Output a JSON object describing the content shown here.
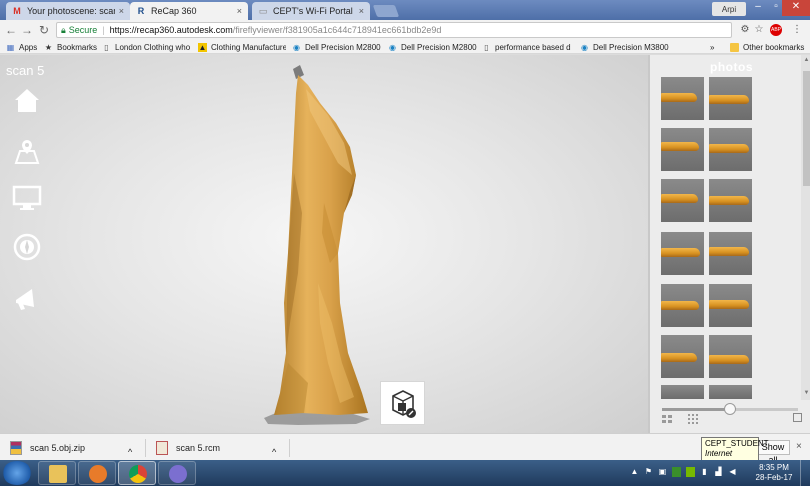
{
  "browser": {
    "tabs": [
      {
        "title": "Your photoscene: scan 5",
        "favicon": "gmail-icon",
        "favicon_glyph": "M",
        "favicon_color": "#d93025",
        "close": "×"
      },
      {
        "title": "ReCap 360",
        "favicon": "recap-icon",
        "favicon_glyph": "R",
        "favicon_color": "#1f4e8c",
        "close": "×"
      },
      {
        "title": "CEPT's Wi-Fi Portal",
        "favicon": "page-icon",
        "favicon_glyph": "▭",
        "favicon_color": "#888888",
        "close": "×"
      }
    ],
    "profile_label": "Arpi",
    "address": {
      "secure_label": "Secure",
      "host": "https://recap360.autodesk.com",
      "path": "/fireflyviewer/f381905a1c644c718941ec661bdb2e9d"
    },
    "bookmarks": [
      {
        "label": "Apps",
        "icon": "apps-grid-icon",
        "glyph": "⋮⋮"
      },
      {
        "label": "Bookmarks",
        "icon": "star-icon",
        "glyph": "★"
      },
      {
        "label": "London Clothing who",
        "icon": "page-icon",
        "glyph": "▯"
      },
      {
        "label": "Clothing Manufacture",
        "icon": "warning-icon",
        "glyph": "▲"
      },
      {
        "label": "Dell Precision M2800",
        "icon": "dell-icon",
        "glyph": "◉"
      },
      {
        "label": "Dell Precision M2800",
        "icon": "dell-icon",
        "glyph": "◉"
      },
      {
        "label": "performance based d",
        "icon": "page-icon",
        "glyph": "▯"
      },
      {
        "label": "Dell Precision M3800",
        "icon": "dell-icon",
        "glyph": "◉"
      }
    ],
    "bookmarks_more": "»",
    "other_bookmarks": "Other bookmarks"
  },
  "viewer": {
    "title": "scan 5",
    "sidebar_icons": [
      "home-icon",
      "map-location-icon",
      "monitor-icon",
      "compass-icon",
      "megaphone-icon"
    ]
  },
  "photos": {
    "title": "photos",
    "thumbnail_rows": 7,
    "zoom_slider_value": 0.5
  },
  "downloads": {
    "items": [
      {
        "name": "scan 5.obj.zip",
        "chevron": "^"
      },
      {
        "name": "scan 5.rcm",
        "chevron": "^"
      }
    ],
    "show_all": "Show all",
    "close": "×"
  },
  "tooltip": {
    "line1": "CEPT_STUDENT",
    "line2": "Internet access"
  },
  "taskbar": {
    "clock_time": "8:35 PM",
    "clock_date": "28-Feb-17"
  },
  "colors": {
    "model_light": "#e8b55a",
    "model_mid": "#c98d2e",
    "model_dark": "#9b6a23",
    "secure_green": "#188038"
  }
}
